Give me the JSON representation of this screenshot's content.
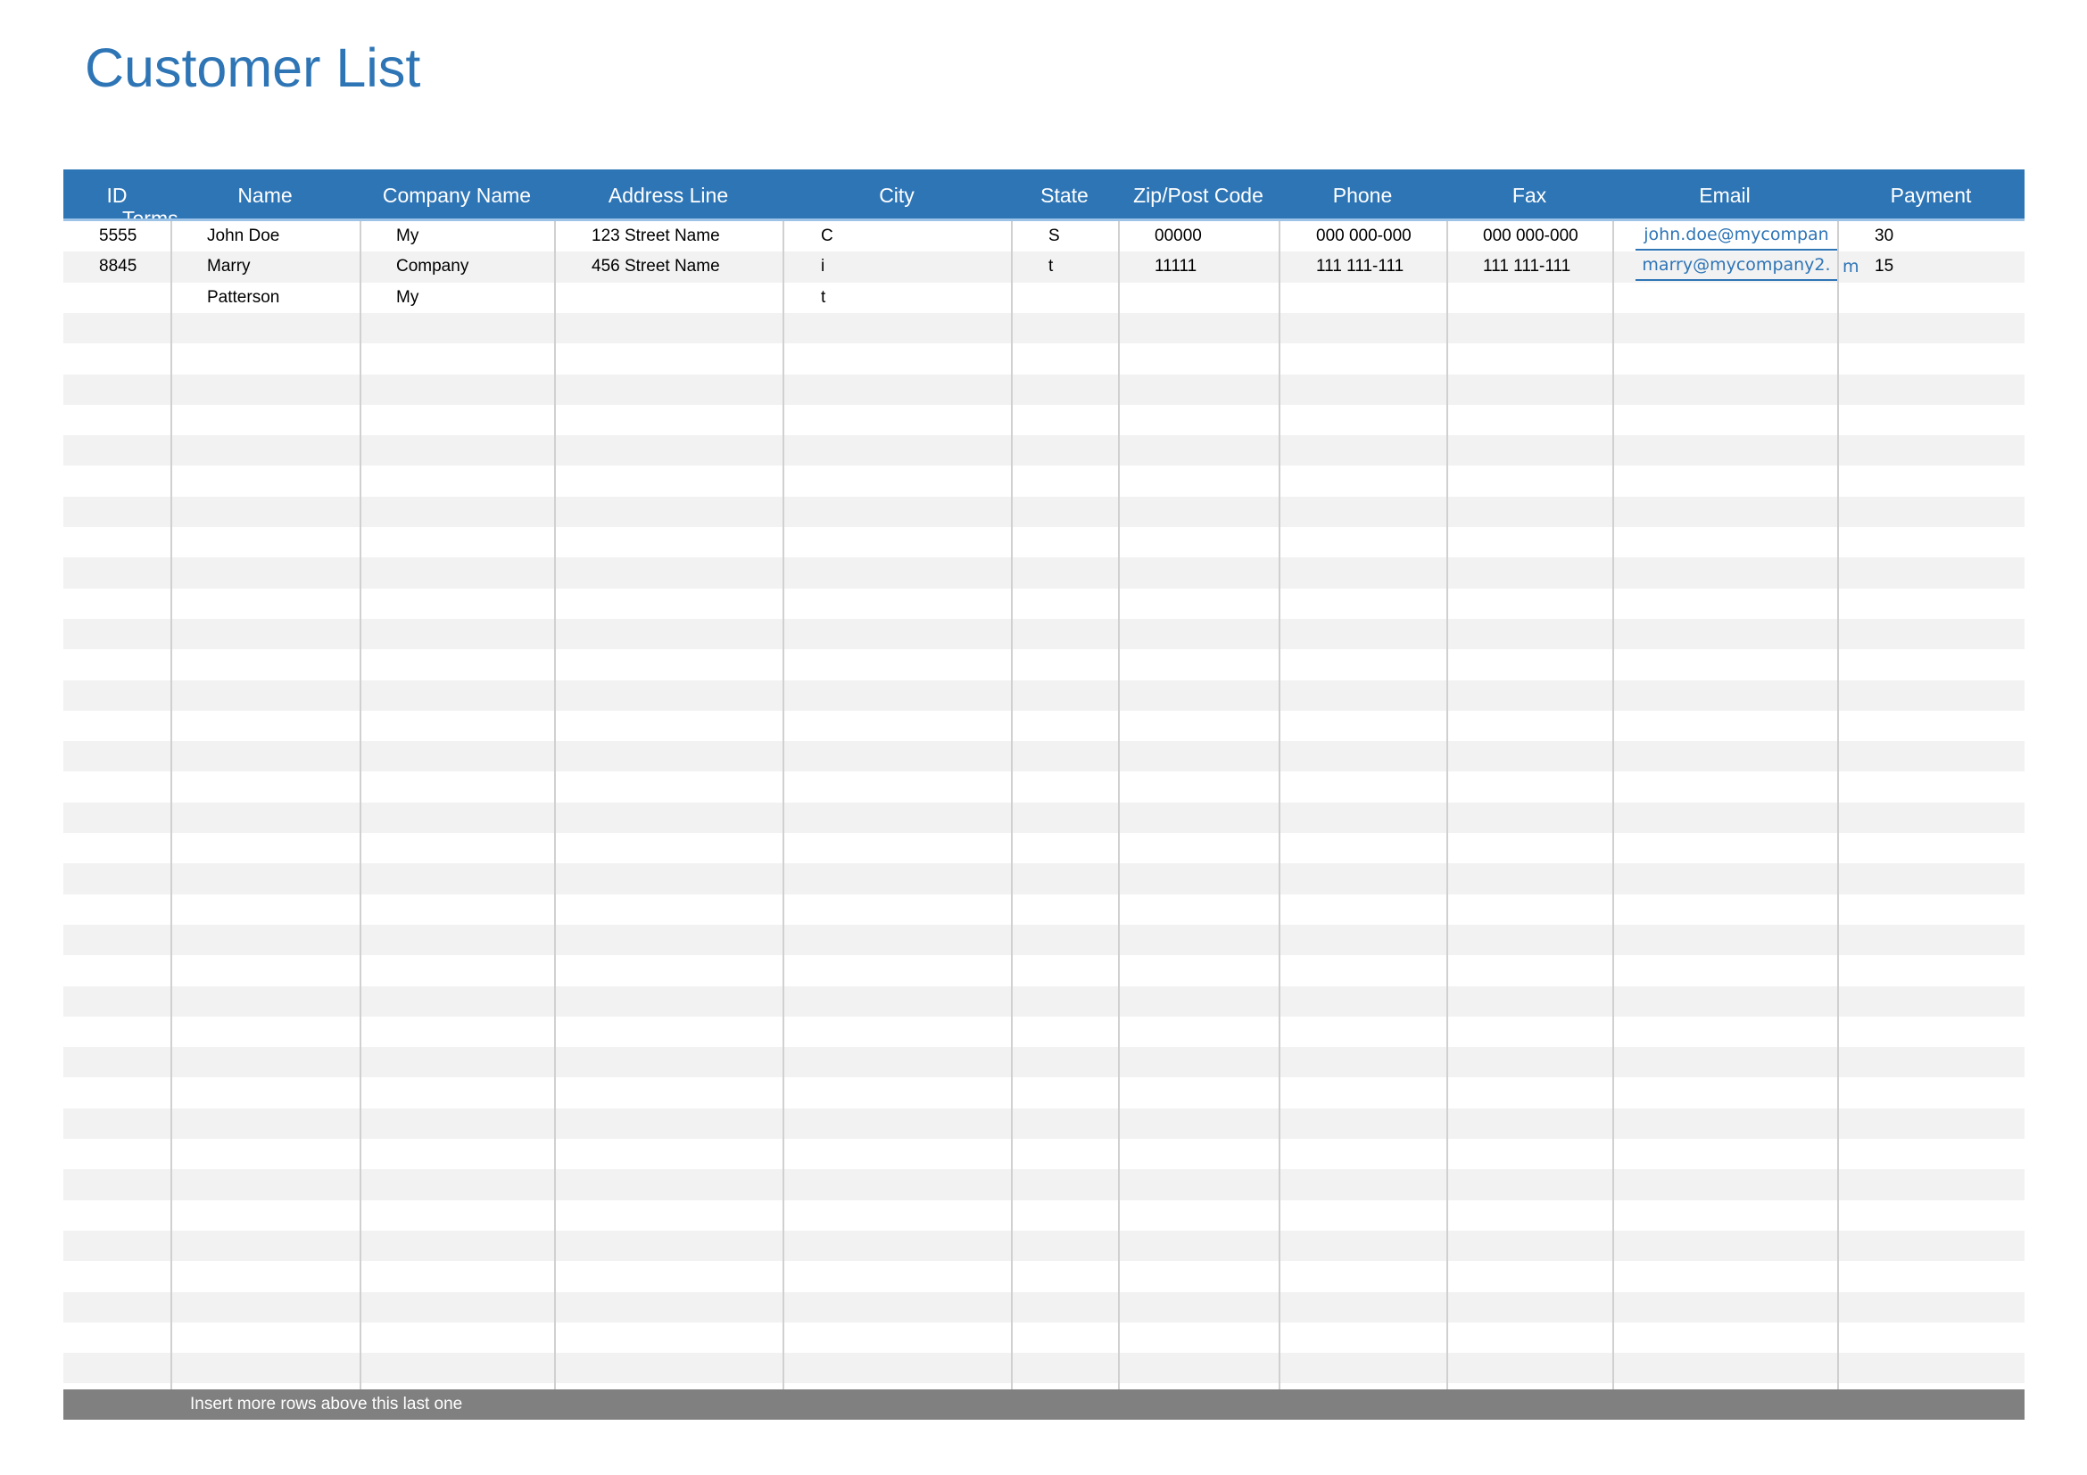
{
  "title": "Customer List",
  "columns": [
    {
      "key": "id",
      "label": "ID"
    },
    {
      "key": "name",
      "label": "Name"
    },
    {
      "key": "company",
      "label": "Company Name"
    },
    {
      "key": "address",
      "label": "Address Line"
    },
    {
      "key": "city",
      "label": "City"
    },
    {
      "key": "state",
      "label": "State"
    },
    {
      "key": "zip",
      "label": "Zip/Post  Code"
    },
    {
      "key": "phone",
      "label": "Phone"
    },
    {
      "key": "fax",
      "label": "Fax"
    },
    {
      "key": "email",
      "label": "Email"
    },
    {
      "key": "payment",
      "label": "Payment"
    }
  ],
  "header_overflow_text": "Terms",
  "rows": [
    {
      "id": "5555",
      "name": "John Doe",
      "company": "My",
      "address": "123 Street Name",
      "city": "C",
      "state": "S",
      "zip": "00000",
      "phone": "000 000-000",
      "fax": "000 000-000",
      "email": "john.doe@mycompan",
      "email_tail": "",
      "payment": "30"
    },
    {
      "id": "8845",
      "name": "Marry",
      "company": "Company",
      "address": "456 Street Name",
      "city": "i",
      "state": "t",
      "zip": "11111",
      "phone": "111 111-111",
      "fax": "111 111-111",
      "email": "marry@mycompany2.",
      "email_tail": "m",
      "payment": "15"
    },
    {
      "id": "",
      "name": "Patterson",
      "company": "My",
      "address": "",
      "city": "t",
      "state": "",
      "zip": "",
      "phone": "",
      "fax": "",
      "email": "",
      "email_tail": "",
      "payment": ""
    }
  ],
  "footer_text": "Insert more rows above this last one",
  "colors": {
    "accent": "#2e75b6",
    "stripe": "#f2f2f2",
    "footer": "#808080",
    "grid": "#d0d0d0"
  }
}
